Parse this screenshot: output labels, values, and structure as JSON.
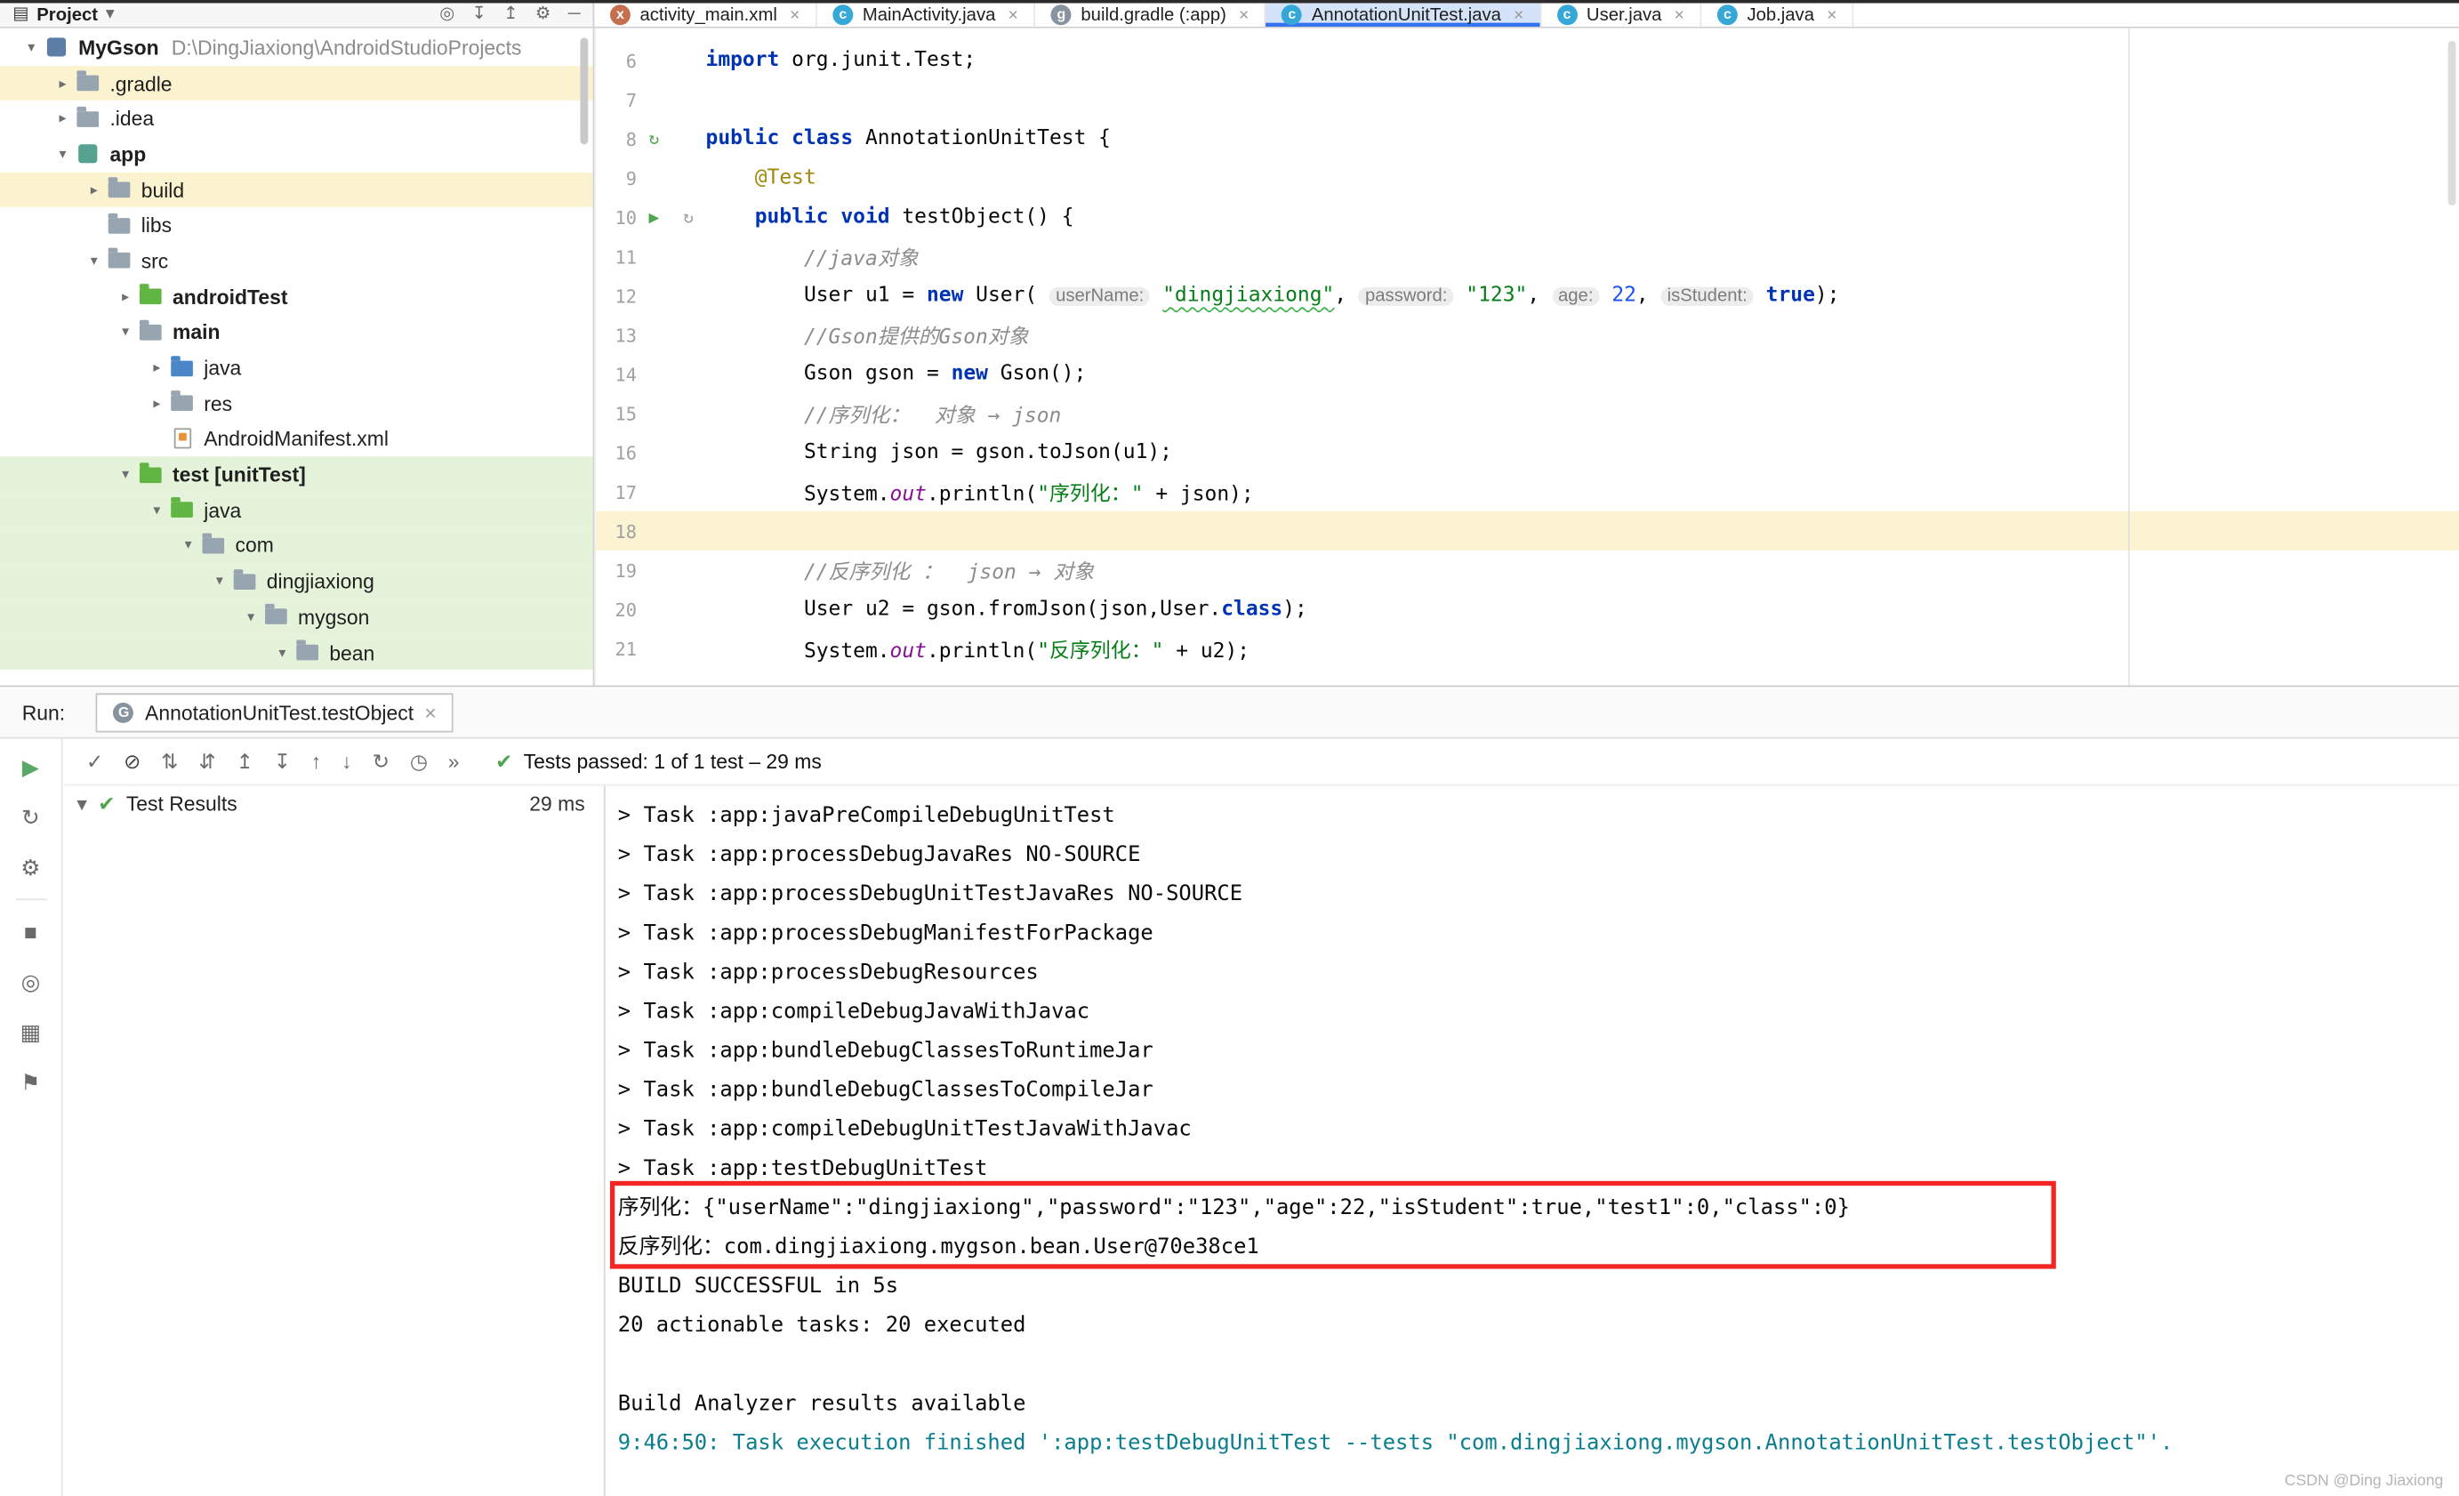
{
  "colors": {
    "accent_blue": "#3574F0",
    "test_green": "#4DA54D",
    "highlight_red": "#F32525",
    "row_yellow": "#FBF3CF",
    "row_green": "#E5F3DB",
    "current_line_yellow": "#FCF3D3"
  },
  "window": {
    "watermark": "CSDN @Ding Jiaxiong"
  },
  "project_panel": {
    "header": {
      "view_icon": {
        "name": "project-view-icon",
        "glyph": "▤",
        "color": "#3f3f3f"
      },
      "title": "Project",
      "caret_icon": {
        "name": "chevron-down-icon",
        "glyph": "▾",
        "color": "#6a6a6a"
      },
      "actions": [
        {
          "name": "select-opened-file-icon",
          "glyph": "◎"
        },
        {
          "name": "scroll-from-source-icon",
          "glyph": "↧"
        },
        {
          "name": "collapse-all-icon",
          "glyph": "↥"
        },
        {
          "name": "settings-gear-icon",
          "glyph": "⚙"
        },
        {
          "name": "hide-panel-icon",
          "glyph": "─"
        }
      ]
    },
    "tree": [
      {
        "label": "MyGson",
        "path": "D:\\DingJiaxiong\\AndroidStudioProjects",
        "level": 0,
        "chevron": "down",
        "bold": true,
        "icon": {
          "name": "project-icon",
          "kind": "square",
          "color": "#5c7ea6"
        }
      },
      {
        "label": ".gradle",
        "level": 1,
        "chevron": "right",
        "highlight": "yellow",
        "icon": {
          "name": "folder-icon",
          "kind": "folder",
          "color": "#97a5b0"
        }
      },
      {
        "label": ".idea",
        "level": 1,
        "chevron": "right",
        "icon": {
          "name": "folder-icon",
          "kind": "folder",
          "color": "#97a5b0"
        }
      },
      {
        "label": "app",
        "level": 1,
        "chevron": "down",
        "bold": true,
        "icon": {
          "name": "app-module-icon",
          "kind": "square",
          "color": "#55a291"
        }
      },
      {
        "label": "build",
        "level": 2,
        "chevron": "right",
        "highlight": "yellow",
        "icon": {
          "name": "build-folder-icon",
          "kind": "folder",
          "color": "#97a5b0"
        }
      },
      {
        "label": "libs",
        "level": 2,
        "chevron": "none",
        "icon": {
          "name": "folder-icon",
          "kind": "folder",
          "color": "#97a5b0"
        }
      },
      {
        "label": "src",
        "level": 2,
        "chevron": "down",
        "icon": {
          "name": "folder-icon",
          "kind": "folder",
          "color": "#97a5b0"
        }
      },
      {
        "label": "androidTest",
        "level": 3,
        "chevron": "right",
        "bold": true,
        "icon": {
          "name": "test-folder-icon",
          "kind": "folder",
          "color": "#61b543"
        }
      },
      {
        "label": "main",
        "level": 3,
        "chevron": "down",
        "bold": true,
        "icon": {
          "name": "folder-icon",
          "kind": "folder",
          "color": "#97a5b0"
        }
      },
      {
        "label": "java",
        "level": 4,
        "chevron": "right",
        "icon": {
          "name": "source-folder-icon",
          "kind": "folder",
          "color": "#4a86c8"
        }
      },
      {
        "label": "res",
        "level": 4,
        "chevron": "right",
        "icon": {
          "name": "res-folder-icon",
          "kind": "folder",
          "color": "#97a5b0"
        }
      },
      {
        "label": "AndroidManifest.xml",
        "level": 4,
        "chevron": "none",
        "icon": {
          "name": "manifest-file-icon",
          "kind": "file"
        }
      },
      {
        "label": "test [unitTest]",
        "level": 3,
        "chevron": "down",
        "bold": true,
        "highlight": "green",
        "icon": {
          "name": "test-folder-icon",
          "kind": "folder",
          "color": "#61b543"
        }
      },
      {
        "label": "java",
        "level": 4,
        "chevron": "down",
        "highlight": "green",
        "icon": {
          "name": "test-folder-icon",
          "kind": "folder",
          "color": "#61b543"
        }
      },
      {
        "label": "com",
        "level": 5,
        "chevron": "down",
        "highlight": "green",
        "icon": {
          "name": "package-folder-icon",
          "kind": "folder",
          "color": "#97a5b0"
        }
      },
      {
        "label": "dingjiaxiong",
        "level": 6,
        "chevron": "down",
        "highlight": "green",
        "icon": {
          "name": "package-folder-icon",
          "kind": "folder",
          "color": "#97a5b0"
        }
      },
      {
        "label": "mygson",
        "level": 7,
        "chevron": "down",
        "highlight": "green",
        "icon": {
          "name": "package-folder-icon",
          "kind": "folder",
          "color": "#97a5b0"
        }
      },
      {
        "label": "bean",
        "level": 8,
        "chevron": "down",
        "highlight": "green",
        "icon": {
          "name": "package-folder-icon",
          "kind": "folder",
          "color": "#97a5b0"
        }
      }
    ]
  },
  "editor_tabs": [
    {
      "label": "activity_main.xml",
      "selected": false,
      "icon": {
        "name": "xml-file-icon",
        "kind": "circle",
        "color": "#c4704f",
        "letter": "x"
      }
    },
    {
      "label": "MainActivity.java",
      "selected": false,
      "icon": {
        "name": "java-class-icon",
        "kind": "circle",
        "color": "#35a8d8",
        "letter": "c"
      }
    },
    {
      "label": "build.gradle (:app)",
      "selected": false,
      "icon": {
        "name": "gradle-file-icon",
        "kind": "circle",
        "color": "#87939e",
        "letter": "g"
      }
    },
    {
      "label": "AnnotationUnitTest.java",
      "selected": true,
      "icon": {
        "name": "java-class-icon",
        "kind": "circle",
        "color": "#35a8d8",
        "letter": "c"
      }
    },
    {
      "label": "User.java",
      "selected": false,
      "icon": {
        "name": "java-class-icon",
        "kind": "circle",
        "color": "#35a8d8",
        "letter": "c"
      }
    },
    {
      "label": "Job.java",
      "selected": false,
      "icon": {
        "name": "java-class-icon",
        "kind": "circle",
        "color": "#35a8d8",
        "letter": "c"
      }
    }
  ],
  "editor": {
    "current_line": 18,
    "lines": [
      {
        "n": 6,
        "tokens": [
          {
            "t": "import",
            "c": "kw"
          },
          {
            "t": " org.junit.Test;",
            "c": "pl"
          }
        ]
      },
      {
        "n": 7,
        "tokens": []
      },
      {
        "n": 8,
        "gutter_icon": {
          "name": "run-test-class-icon",
          "glyph": "↻",
          "color": "#4da54d"
        },
        "tokens": [
          {
            "t": "public class",
            "c": "kw"
          },
          {
            "t": " AnnotationUnitTest {",
            "c": "pl"
          }
        ]
      },
      {
        "n": 9,
        "tokens": [
          {
            "t": "    ",
            "c": "pl"
          },
          {
            "t": "@Test",
            "c": "ann"
          }
        ]
      },
      {
        "n": 10,
        "gutter_icon": {
          "name": "run-test-method-icon",
          "glyph": "▶",
          "color": "#4da54d"
        },
        "extra_icon": {
          "name": "test-state-icon",
          "glyph": "↻",
          "color": "#9a9a9a"
        },
        "tokens": [
          {
            "t": "    ",
            "c": "pl"
          },
          {
            "t": "public void",
            "c": "kw"
          },
          {
            "t": " testObject() {",
            "c": "pl"
          }
        ]
      },
      {
        "n": 11,
        "tokens": [
          {
            "t": "        ",
            "c": "pl"
          },
          {
            "t": "//java对象",
            "c": "cm"
          }
        ]
      },
      {
        "n": 12,
        "tokens": [
          {
            "t": "        User u1 = ",
            "c": "pl"
          },
          {
            "t": "new",
            "c": "kw"
          },
          {
            "t": " User( ",
            "c": "pl"
          },
          {
            "t": "userName:",
            "c": "hint"
          },
          {
            "t": " ",
            "c": "pl"
          },
          {
            "t": "\"dingjiaxiong\"",
            "c": "str wavy"
          },
          {
            "t": ", ",
            "c": "pl"
          },
          {
            "t": "password:",
            "c": "hint"
          },
          {
            "t": " ",
            "c": "pl"
          },
          {
            "t": "\"123\"",
            "c": "str"
          },
          {
            "t": ", ",
            "c": "pl"
          },
          {
            "t": "age:",
            "c": "hint"
          },
          {
            "t": " ",
            "c": "pl"
          },
          {
            "t": "22",
            "c": "num"
          },
          {
            "t": ", ",
            "c": "pl"
          },
          {
            "t": "isStudent:",
            "c": "hint"
          },
          {
            "t": " ",
            "c": "pl"
          },
          {
            "t": "true",
            "c": "kw"
          },
          {
            "t": ");",
            "c": "pl"
          }
        ]
      },
      {
        "n": 13,
        "tokens": [
          {
            "t": "        ",
            "c": "pl"
          },
          {
            "t": "//Gson提供的Gson对象",
            "c": "cm"
          }
        ]
      },
      {
        "n": 14,
        "tokens": [
          {
            "t": "        Gson gson = ",
            "c": "pl"
          },
          {
            "t": "new",
            "c": "kw"
          },
          {
            "t": " Gson();",
            "c": "pl"
          }
        ]
      },
      {
        "n": 15,
        "tokens": [
          {
            "t": "        ",
            "c": "pl"
          },
          {
            "t": "//序列化：  对象 → json",
            "c": "cm"
          }
        ]
      },
      {
        "n": 16,
        "tokens": [
          {
            "t": "        String json = gson.toJson(u1);",
            "c": "pl"
          }
        ]
      },
      {
        "n": 17,
        "tokens": [
          {
            "t": "        System.",
            "c": "pl"
          },
          {
            "t": "out",
            "c": "fld"
          },
          {
            "t": ".println(",
            "c": "pl"
          },
          {
            "t": "\"序列化：\"",
            "c": "str"
          },
          {
            "t": " + json);",
            "c": "pl"
          }
        ]
      },
      {
        "n": 18,
        "tokens": []
      },
      {
        "n": 19,
        "tokens": [
          {
            "t": "        ",
            "c": "pl"
          },
          {
            "t": "//反序列化 ：  json → 对象",
            "c": "cm"
          }
        ]
      },
      {
        "n": 20,
        "tokens": [
          {
            "t": "        User u2 = gson.fromJson(json,User.",
            "c": "pl"
          },
          {
            "t": "class",
            "c": "kw"
          },
          {
            "t": ");",
            "c": "pl"
          }
        ]
      },
      {
        "n": 21,
        "tokens": [
          {
            "t": "        System.",
            "c": "pl"
          },
          {
            "t": "out",
            "c": "fld"
          },
          {
            "t": ".println(",
            "c": "pl"
          },
          {
            "t": "\"反序列化：\"",
            "c": "str"
          },
          {
            "t": " + u2);",
            "c": "pl"
          }
        ]
      }
    ]
  },
  "run_panel": {
    "label": "Run:",
    "tab": {
      "icon": {
        "name": "gradle-icon",
        "kind": "circle",
        "color": "#87939e",
        "letter": "G"
      },
      "title": "AnnotationUnitTest.testObject",
      "close_icon": {
        "name": "close-icon",
        "glyph": "×"
      }
    },
    "left_icons": [
      {
        "name": "rerun-icon",
        "glyph": "▶",
        "color": "#59a869"
      },
      {
        "name": "rerun-failed-tests-icon",
        "glyph": "↻"
      },
      {
        "name": "test-settings-icon",
        "glyph": "⚙"
      },
      {
        "name": "stop-icon",
        "glyph": "■"
      },
      {
        "name": "coverage-icon",
        "glyph": "◎"
      },
      {
        "name": "layout-icon",
        "glyph": "▦"
      },
      {
        "name": "pin-icon",
        "glyph": "⚑"
      }
    ],
    "toolbar_icons": [
      {
        "name": "show-passed-icon",
        "glyph": "✓"
      },
      {
        "name": "show-ignored-icon",
        "glyph": "⊘",
        "color": "#444444"
      },
      {
        "name": "sort-alphabetically-icon",
        "glyph": "⇅"
      },
      {
        "name": "sort-by-duration-icon",
        "glyph": "⇵"
      },
      {
        "name": "collapse-all-icon",
        "glyph": "↥"
      },
      {
        "name": "expand-all-icon",
        "glyph": "↧"
      },
      {
        "name": "previous-failed-test-icon",
        "glyph": "↑"
      },
      {
        "name": "next-failed-test-icon",
        "glyph": "↓"
      },
      {
        "name": "rerun-failed-icon",
        "glyph": "↻"
      },
      {
        "name": "test-history-icon",
        "glyph": "◷"
      },
      {
        "name": "more-icon",
        "glyph": "»"
      }
    ],
    "status": {
      "icon": {
        "name": "tests-passed-icon",
        "glyph": "✔",
        "color": "#4da54d"
      },
      "text": "Tests passed: 1 of 1 test – 29 ms"
    },
    "test_results": {
      "chevron_icon": {
        "name": "chevron-down-icon",
        "glyph": "▾",
        "color": "#6a6a6a"
      },
      "status_icon": {
        "name": "test-passed-icon",
        "glyph": "✔",
        "color": "#4da54d"
      },
      "label": "Test Results",
      "duration": "29 ms"
    },
    "console": {
      "lines": [
        {
          "text": "> Task :app:javaPreCompileDebugUnitTest"
        },
        {
          "text": "> Task :app:processDebugJavaRes NO-SOURCE"
        },
        {
          "text": "> Task :app:processDebugUnitTestJavaRes NO-SOURCE"
        },
        {
          "text": "> Task :app:processDebugManifestForPackage"
        },
        {
          "text": "> Task :app:processDebugResources"
        },
        {
          "text": "> Task :app:compileDebugJavaWithJavac"
        },
        {
          "text": "> Task :app:bundleDebugClassesToRuntimeJar"
        },
        {
          "text": "> Task :app:bundleDebugClassesToCompileJar"
        },
        {
          "text": "> Task :app:compileDebugUnitTestJavaWithJavac"
        },
        {
          "text": "> Task :app:testDebugUnitTest"
        },
        {
          "text": "序列化：{\"userName\":\"dingjiaxiong\",\"password\":\"123\",\"age\":22,\"isStudent\":true,\"test1\":0,\"class\":0}",
          "highlighted": true
        },
        {
          "text": "反序列化：com.dingjiaxiong.mygson.bean.User@70e38ce1",
          "highlighted": true
        },
        {
          "text": "BUILD SUCCESSFUL in 5s"
        },
        {
          "text": "20 actionable tasks: 20 executed"
        },
        {
          "text": ""
        },
        {
          "text": "Build Analyzer results available"
        },
        {
          "text": "9:46:50: Task execution finished ':app:testDebugUnitTest --tests \"com.dingjiaxiong.mygson.AnnotationUnitTest.testObject\"'.",
          "cls": "teal"
        }
      ]
    }
  }
}
